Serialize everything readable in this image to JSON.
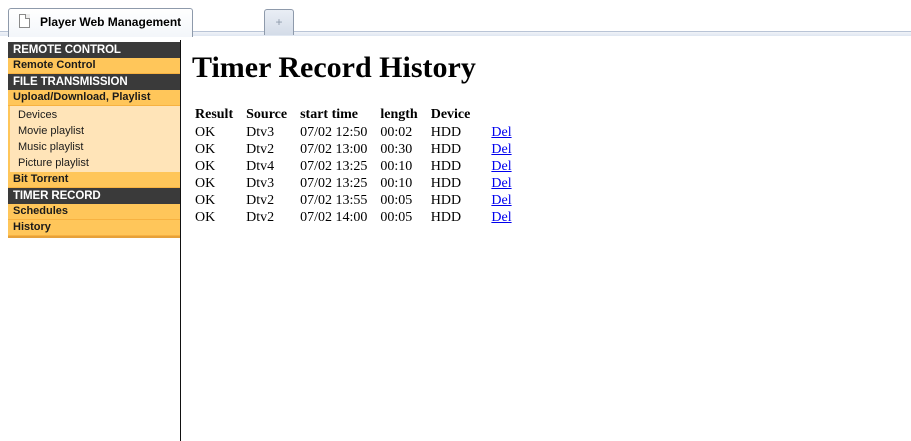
{
  "browser": {
    "tab_title": "Player Web Management",
    "new_tab_glyph": "+",
    "icons": {
      "page": "page-icon",
      "new_tab": "plus-icon"
    }
  },
  "sidebar": {
    "sections": [
      {
        "title": "REMOTE CONTROL",
        "items": [
          {
            "label": "Remote Control"
          }
        ]
      },
      {
        "title": "FILE TRANSMISSION",
        "items": [
          {
            "label": "Upload/Download, Playlist",
            "children": [
              "Devices",
              "Movie playlist",
              "Music playlist",
              "Picture playlist"
            ]
          },
          {
            "label": "Bit Torrent"
          }
        ]
      },
      {
        "title": "TIMER RECORD",
        "items": [
          {
            "label": "Schedules"
          },
          {
            "label": "History"
          }
        ]
      }
    ],
    "colors": {
      "header_bg": "#3a3a3a",
      "item_bg": "#ffc65a",
      "sub_bg": "#ffe4b8"
    }
  },
  "main": {
    "title": "Timer Record History",
    "columns": [
      "Result",
      "Source",
      "start time",
      "length",
      "Device",
      ""
    ],
    "rows": [
      [
        "OK",
        "Dtv3",
        "07/02 12:50",
        "00:02",
        "HDD",
        "Del"
      ],
      [
        "OK",
        "Dtv2",
        "07/02 13:00",
        "00:30",
        "HDD",
        "Del"
      ],
      [
        "OK",
        "Dtv4",
        "07/02 13:25",
        "00:10",
        "HDD",
        "Del"
      ],
      [
        "OK",
        "Dtv3",
        "07/02 13:25",
        "00:10",
        "HDD",
        "Del"
      ],
      [
        "OK",
        "Dtv2",
        "07/02 13:55",
        "00:05",
        "HDD",
        "Del"
      ],
      [
        "OK",
        "Dtv2",
        "07/02 14:00",
        "00:05",
        "HDD",
        "Del"
      ]
    ],
    "link_color": "#0000ee"
  }
}
